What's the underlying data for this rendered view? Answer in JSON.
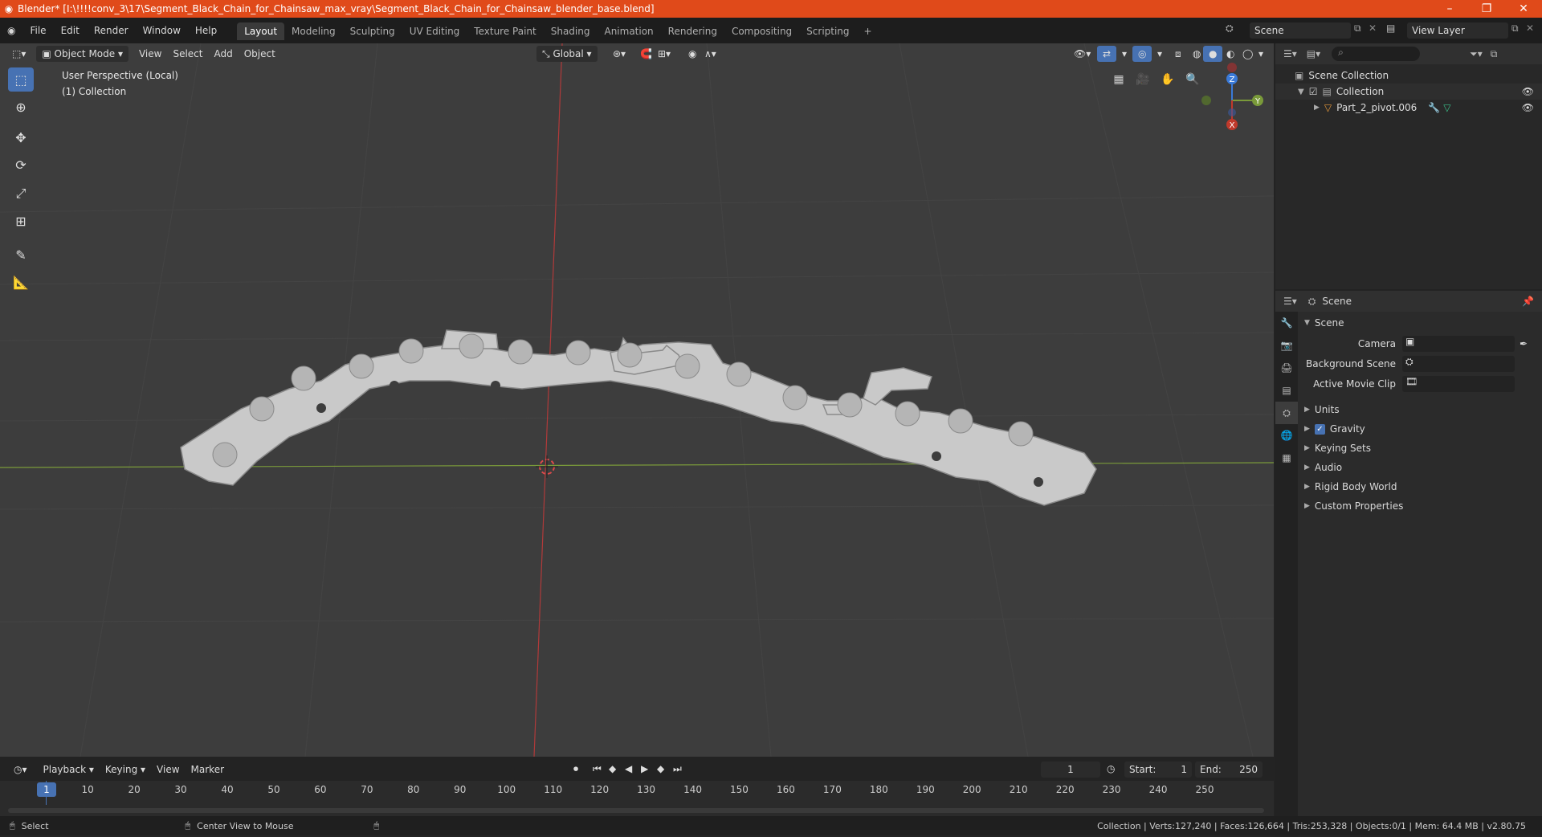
{
  "titlebar": {
    "title": "Blender* [I:\\!!!!conv_3\\17\\Segment_Black_Chain_for_Chainsaw_max_vray\\Segment_Black_Chain_for_Chainsaw_blender_base.blend]",
    "minimize": "–",
    "maximize": "❐",
    "close": "✕"
  },
  "menu": [
    "File",
    "Edit",
    "Render",
    "Window",
    "Help"
  ],
  "workspaces": [
    "Layout",
    "Modeling",
    "Sculpting",
    "UV Editing",
    "Texture Paint",
    "Shading",
    "Animation",
    "Rendering",
    "Compositing",
    "Scripting"
  ],
  "workspace_add": "+",
  "scene_field": "Scene",
  "view_layer_field": "View Layer",
  "viewport": {
    "mode": "Object Mode",
    "menus": [
      "View",
      "Select",
      "Add",
      "Object"
    ],
    "transform_orientation": "Global",
    "overlay_line1": "User Perspective (Local)",
    "overlay_line2": "(1) Collection",
    "gizmo": {
      "x": "X",
      "y": "Y",
      "z": "Z"
    }
  },
  "outliner": {
    "root": "Scene Collection",
    "collection": "Collection",
    "object": "Part_2_pivot.006"
  },
  "properties": {
    "header": "Scene",
    "panel_title": "Scene",
    "camera_label": "Camera",
    "background_scene_label": "Background Scene",
    "active_movie_clip_label": "Active Movie Clip",
    "sections": [
      "Units",
      "Gravity",
      "Keying Sets",
      "Audio",
      "Rigid Body World",
      "Custom Properties"
    ]
  },
  "timeline": {
    "menus": [
      "Playback",
      "Keying",
      "View",
      "Marker"
    ],
    "current_frame": "1",
    "start_label": "Start:",
    "start": "1",
    "end_label": "End:",
    "end": "250",
    "ticks": [
      "1",
      "10",
      "20",
      "30",
      "40",
      "50",
      "60",
      "70",
      "80",
      "90",
      "100",
      "110",
      "120",
      "130",
      "140",
      "150",
      "160",
      "170",
      "180",
      "190",
      "200",
      "210",
      "220",
      "230",
      "240",
      "250"
    ]
  },
  "statusbar": {
    "select": "Select",
    "center_view": "Center View to Mouse",
    "stats": "Collection | Verts:127,240 | Faces:126,664 | Tris:253,328 | Objects:0/1 | Mem: 64.4 MB | v2.80.75"
  },
  "colors": {
    "titlebar": "#e04a1a",
    "accent": "#4772b3",
    "x_axis": "#c0392b",
    "y_axis": "#7a9a3a",
    "z_axis": "#3a7ad8"
  }
}
